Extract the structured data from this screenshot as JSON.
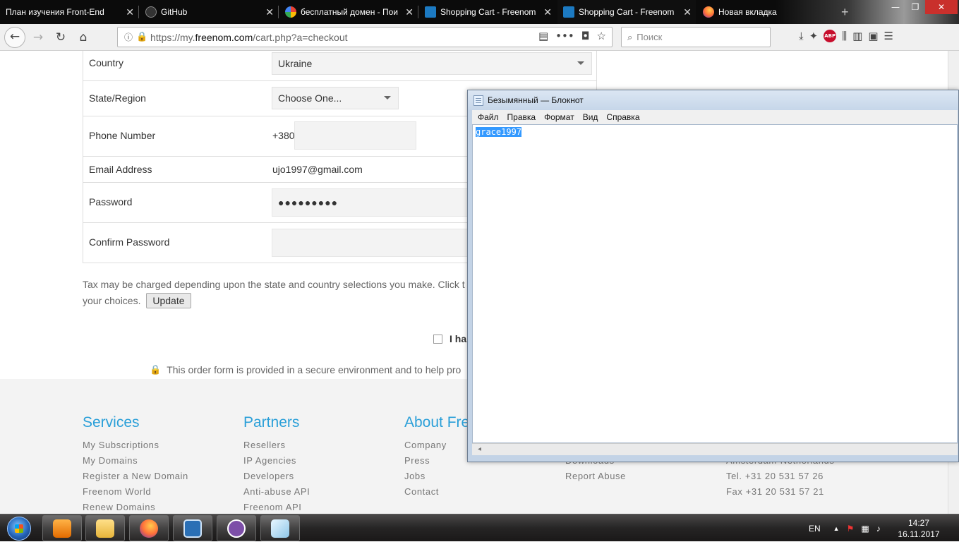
{
  "browser": {
    "tabs": [
      {
        "title": "План изучения Front-End",
        "active": false
      },
      {
        "title": "GitHub",
        "active": false
      },
      {
        "title": "бесплатный домен - Пои",
        "active": false
      },
      {
        "title": "Shopping Cart - Freenom",
        "active": false
      },
      {
        "title": "Shopping Cart - Freenom",
        "active": true
      },
      {
        "title": "Новая вкладка",
        "active": false
      }
    ],
    "url_prefix": "https://my.",
    "url_host": "freenom.com",
    "url_path": "/cart.php?a=checkout",
    "search_placeholder": "Поиск",
    "abp_label": "ABP"
  },
  "form": {
    "country": {
      "label": "Country",
      "value": "Ukraine"
    },
    "state": {
      "label": "State/Region",
      "value": "Choose One..."
    },
    "phone": {
      "label": "Phone Number",
      "prefix": "+380",
      "value": ""
    },
    "email": {
      "label": "Email Address",
      "value": "ujo1997@gmail.com"
    },
    "password": {
      "label": "Password",
      "value": "●●●●●●●●●"
    },
    "confirm_password": {
      "label": "Confirm Password",
      "value": ""
    },
    "tax_note": "Tax may be charged depending upon the state and country selections you make. Click t",
    "tax_note_line2": "your choices.",
    "update_button": "Update",
    "agree_text": "I ha",
    "secure_text": "This order form is provided in a secure environment and to help pro"
  },
  "footer": {
    "columns": [
      {
        "heading": "Services",
        "links": [
          "My Subscriptions",
          "My Domains",
          "Register a New Domain",
          "Freenom World",
          "Renew Domains"
        ]
      },
      {
        "heading": "Partners",
        "links": [
          "Resellers",
          "IP Agencies",
          "Developers",
          "Anti-abuse API",
          "Freenom API"
        ]
      },
      {
        "heading": "About Fre",
        "links": [
          "Company",
          "Press",
          "Jobs",
          "Contact"
        ]
      },
      {
        "heading": "",
        "links": [
          "Downloads",
          "Report Abuse"
        ]
      },
      {
        "heading": "",
        "links": [
          "Amsterdam-Netherlands",
          "Tel. +31 20 531 57 26",
          "Fax +31 20 531 57 21"
        ]
      }
    ]
  },
  "notepad": {
    "title": "Безымянный — Блокнот",
    "menu": [
      "Файл",
      "Правка",
      "Формат",
      "Вид",
      "Справка"
    ],
    "text": "grace1997"
  },
  "taskbar": {
    "language": "EN",
    "time": "14:27",
    "date": "16.11.2017"
  },
  "colors": {
    "accent_link": "#2a9fd8",
    "selection": "#3399ff",
    "win_close": "#c9302c"
  }
}
